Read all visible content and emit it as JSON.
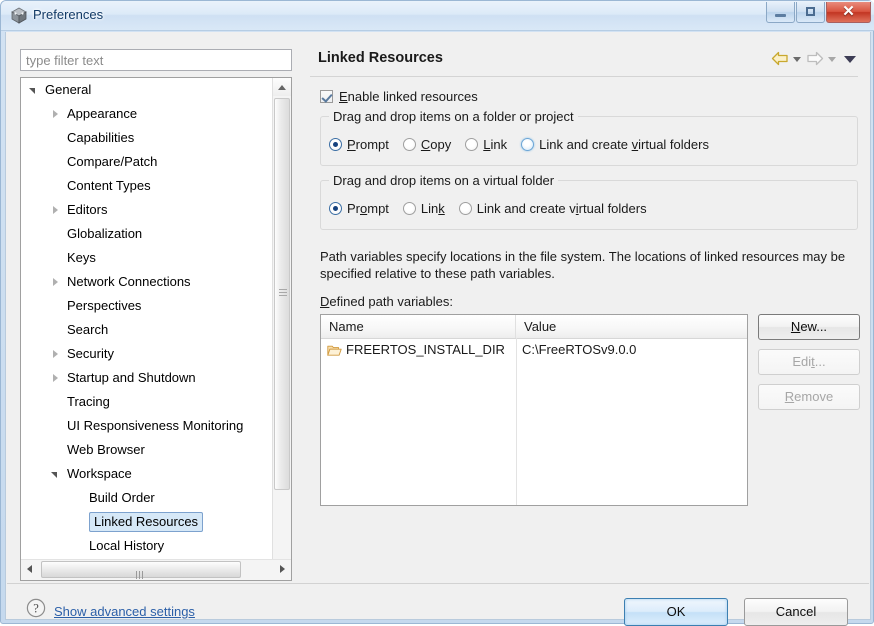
{
  "window": {
    "title": "Preferences",
    "icon": "preferences-cube-icon",
    "controls": {
      "minimize": "minimize-button",
      "maximize": "maximize-button",
      "close": "✕"
    }
  },
  "sidebar": {
    "filter": {
      "placeholder": "type filter text",
      "value": ""
    },
    "tree": [
      {
        "label": "General",
        "indent": 0,
        "twisty": "expanded",
        "selected": false
      },
      {
        "label": "Appearance",
        "indent": 1,
        "twisty": "collapsed",
        "selected": false
      },
      {
        "label": "Capabilities",
        "indent": 1,
        "twisty": "none",
        "selected": false
      },
      {
        "label": "Compare/Patch",
        "indent": 1,
        "twisty": "none",
        "selected": false
      },
      {
        "label": "Content Types",
        "indent": 1,
        "twisty": "none",
        "selected": false
      },
      {
        "label": "Editors",
        "indent": 1,
        "twisty": "collapsed",
        "selected": false
      },
      {
        "label": "Globalization",
        "indent": 1,
        "twisty": "none",
        "selected": false
      },
      {
        "label": "Keys",
        "indent": 1,
        "twisty": "none",
        "selected": false
      },
      {
        "label": "Network Connections",
        "indent": 1,
        "twisty": "collapsed",
        "selected": false
      },
      {
        "label": "Perspectives",
        "indent": 1,
        "twisty": "none",
        "selected": false
      },
      {
        "label": "Search",
        "indent": 1,
        "twisty": "none",
        "selected": false
      },
      {
        "label": "Security",
        "indent": 1,
        "twisty": "collapsed",
        "selected": false
      },
      {
        "label": "Startup and Shutdown",
        "indent": 1,
        "twisty": "collapsed",
        "selected": false
      },
      {
        "label": "Tracing",
        "indent": 1,
        "twisty": "none",
        "selected": false
      },
      {
        "label": "UI Responsiveness Monitoring",
        "indent": 1,
        "twisty": "none",
        "selected": false
      },
      {
        "label": "Web Browser",
        "indent": 1,
        "twisty": "none",
        "selected": false
      },
      {
        "label": "Workspace",
        "indent": 1,
        "twisty": "expanded",
        "selected": false
      },
      {
        "label": "Build Order",
        "indent": 2,
        "twisty": "none",
        "selected": false
      },
      {
        "label": "Linked Resources",
        "indent": 2,
        "twisty": "none",
        "selected": true
      },
      {
        "label": "Local History",
        "indent": 2,
        "twisty": "none",
        "selected": false
      }
    ]
  },
  "page": {
    "title": "Linked Resources",
    "nav": {
      "back": "back-arrow-icon",
      "back_menu": "back-dropdown-icon",
      "forward": "forward-arrow-icon",
      "forward_menu": "forward-dropdown-icon",
      "view_menu": "view-menu-icon"
    },
    "enable_checkbox": {
      "label_pre": "",
      "mnemonic": "E",
      "label_post": "nable linked resources",
      "checked": true
    },
    "group_folder": {
      "title": "Drag and drop items on a folder or project",
      "options": [
        {
          "pre": "",
          "mnemonic": "P",
          "post": "rompt",
          "selected": true,
          "hover": false
        },
        {
          "pre": "",
          "mnemonic": "C",
          "post": "opy",
          "selected": false,
          "hover": false
        },
        {
          "pre": "",
          "mnemonic": "L",
          "post": "ink",
          "selected": false,
          "hover": false
        },
        {
          "pre": "Link and create ",
          "mnemonic": "v",
          "post": "irtual folders",
          "selected": false,
          "hover": true
        }
      ]
    },
    "group_virtual": {
      "title": "Drag and drop items on a virtual folder",
      "options": [
        {
          "pre": "Pr",
          "mnemonic": "o",
          "post": "mpt",
          "selected": true,
          "hover": false
        },
        {
          "pre": "Lin",
          "mnemonic": "k",
          "post": "",
          "selected": false,
          "hover": false
        },
        {
          "pre": "Link and create v",
          "mnemonic": "i",
          "post": "rtual folders",
          "selected": false,
          "hover": false
        }
      ]
    },
    "description": "Path variables specify locations in the file system. The locations of linked resources may be specified relative to these path variables.",
    "defined_label": {
      "pre": "",
      "mnemonic": "D",
      "post": "efined path variables:"
    },
    "table": {
      "columns": [
        "Name",
        "Value"
      ],
      "rows": [
        {
          "icon": "folder-icon",
          "name": "FREERTOS_INSTALL_DIR",
          "value": "C:\\FreeRTOSv9.0.0"
        }
      ]
    },
    "buttons": [
      {
        "pre": "",
        "mnemonic": "N",
        "post": "ew...",
        "enabled": true
      },
      {
        "pre": "Edi",
        "mnemonic": "t",
        "post": "...",
        "enabled": false
      },
      {
        "pre": "",
        "mnemonic": "R",
        "post": "emove",
        "enabled": false
      }
    ]
  },
  "footer": {
    "help_icon": "help-question-icon",
    "advanced_link": "Show advanced settings",
    "ok": "OK",
    "cancel": "Cancel"
  },
  "colors": {
    "accent": "#15417e",
    "link": "#2b5fa8",
    "selection": "#d6e8f7",
    "default_button_border": "#3c7fb1"
  }
}
